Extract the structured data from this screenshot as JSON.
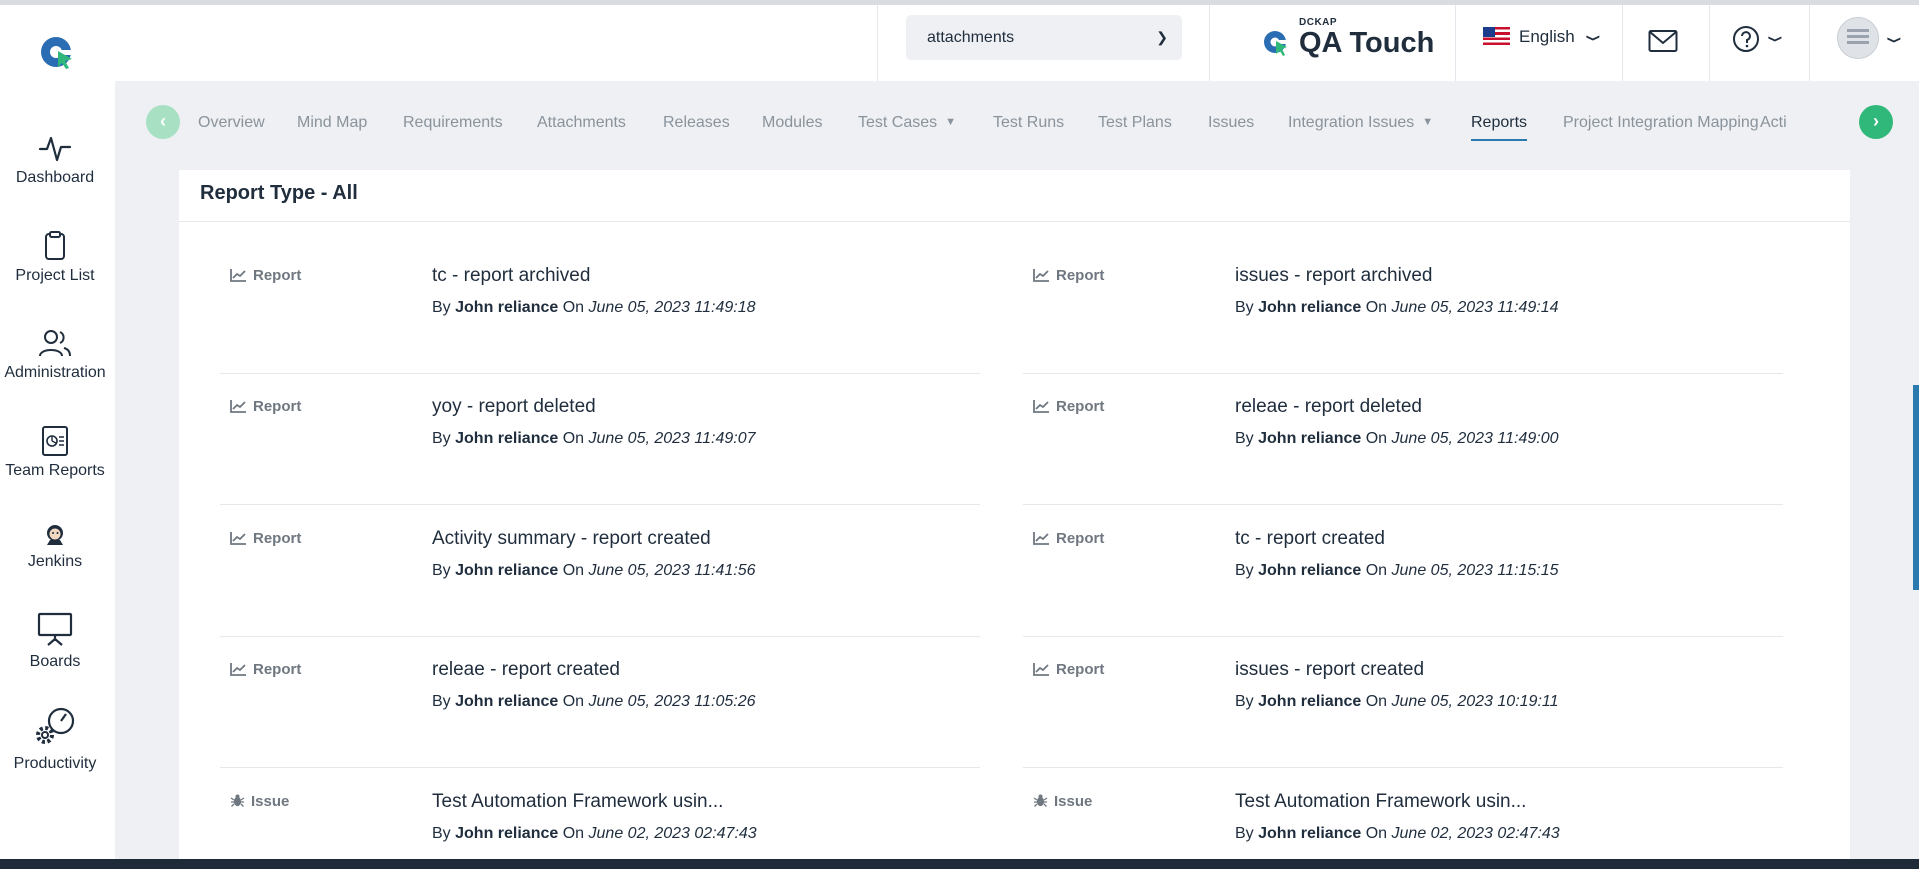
{
  "sidebar": {
    "items": [
      {
        "label": "Dashboard",
        "icon": "pulse-icon"
      },
      {
        "label": "Project List",
        "icon": "clipboard-icon"
      },
      {
        "label": "Administration",
        "icon": "users-icon"
      },
      {
        "label": "Team Reports",
        "icon": "report-icon"
      },
      {
        "label": "Jenkins",
        "icon": "jenkins-icon"
      },
      {
        "label": "Boards",
        "icon": "board-icon"
      },
      {
        "label": "Productivity",
        "icon": "gears-icon"
      }
    ]
  },
  "header": {
    "search_value": "attachments",
    "brand_top": "DCKAP",
    "brand_name": "QA Touch",
    "language": "English"
  },
  "tabs": [
    {
      "label": "Overview"
    },
    {
      "label": "Mind Map"
    },
    {
      "label": "Requirements"
    },
    {
      "label": "Attachments"
    },
    {
      "label": "Releases"
    },
    {
      "label": "Modules"
    },
    {
      "label": "Test Cases"
    },
    {
      "label": "Test Runs"
    },
    {
      "label": "Test Plans"
    },
    {
      "label": "Issues"
    },
    {
      "label": "Integration Issues"
    },
    {
      "label": "Reports"
    },
    {
      "label": "Project Integration Mapping"
    },
    {
      "label": "Acti"
    }
  ],
  "main": {
    "title": "Report Type - All",
    "by_label": "By",
    "on_label": "On",
    "entries": [
      {
        "type": "Report",
        "title": "tc - report archived",
        "user": "John reliance",
        "date": "June 05, 2023 11:49:18"
      },
      {
        "type": "Report",
        "title": "issues - report archived",
        "user": "John reliance",
        "date": "June 05, 2023 11:49:14"
      },
      {
        "type": "Report",
        "title": "yoy - report deleted",
        "user": "John reliance",
        "date": "June 05, 2023 11:49:07"
      },
      {
        "type": "Report",
        "title": "releae - report deleted",
        "user": "John reliance",
        "date": "June 05, 2023 11:49:00"
      },
      {
        "type": "Report",
        "title": "Activity summary - report created",
        "user": "John reliance",
        "date": "June 05, 2023 11:41:56"
      },
      {
        "type": "Report",
        "title": "tc - report created",
        "user": "John reliance",
        "date": "June 05, 2023 11:15:15"
      },
      {
        "type": "Report",
        "title": "releae - report created",
        "user": "John reliance",
        "date": "June 05, 2023 11:05:26"
      },
      {
        "type": "Report",
        "title": "issues - report created",
        "user": "John reliance",
        "date": "June 05, 2023 10:19:11"
      },
      {
        "type": "Issue",
        "title": "Test Automation Framework usin...",
        "user": "John reliance",
        "date": "June 02, 2023 02:47:43"
      },
      {
        "type": "Issue",
        "title": "Test Automation Framework usin...",
        "user": "John reliance",
        "date": "June 02, 2023 02:47:43"
      }
    ]
  },
  "colors": {
    "accent_green": "#2fb87a",
    "accent_blue": "#2a7ab0",
    "text_dark": "#1f2d3d",
    "text_muted": "#8a939c"
  }
}
